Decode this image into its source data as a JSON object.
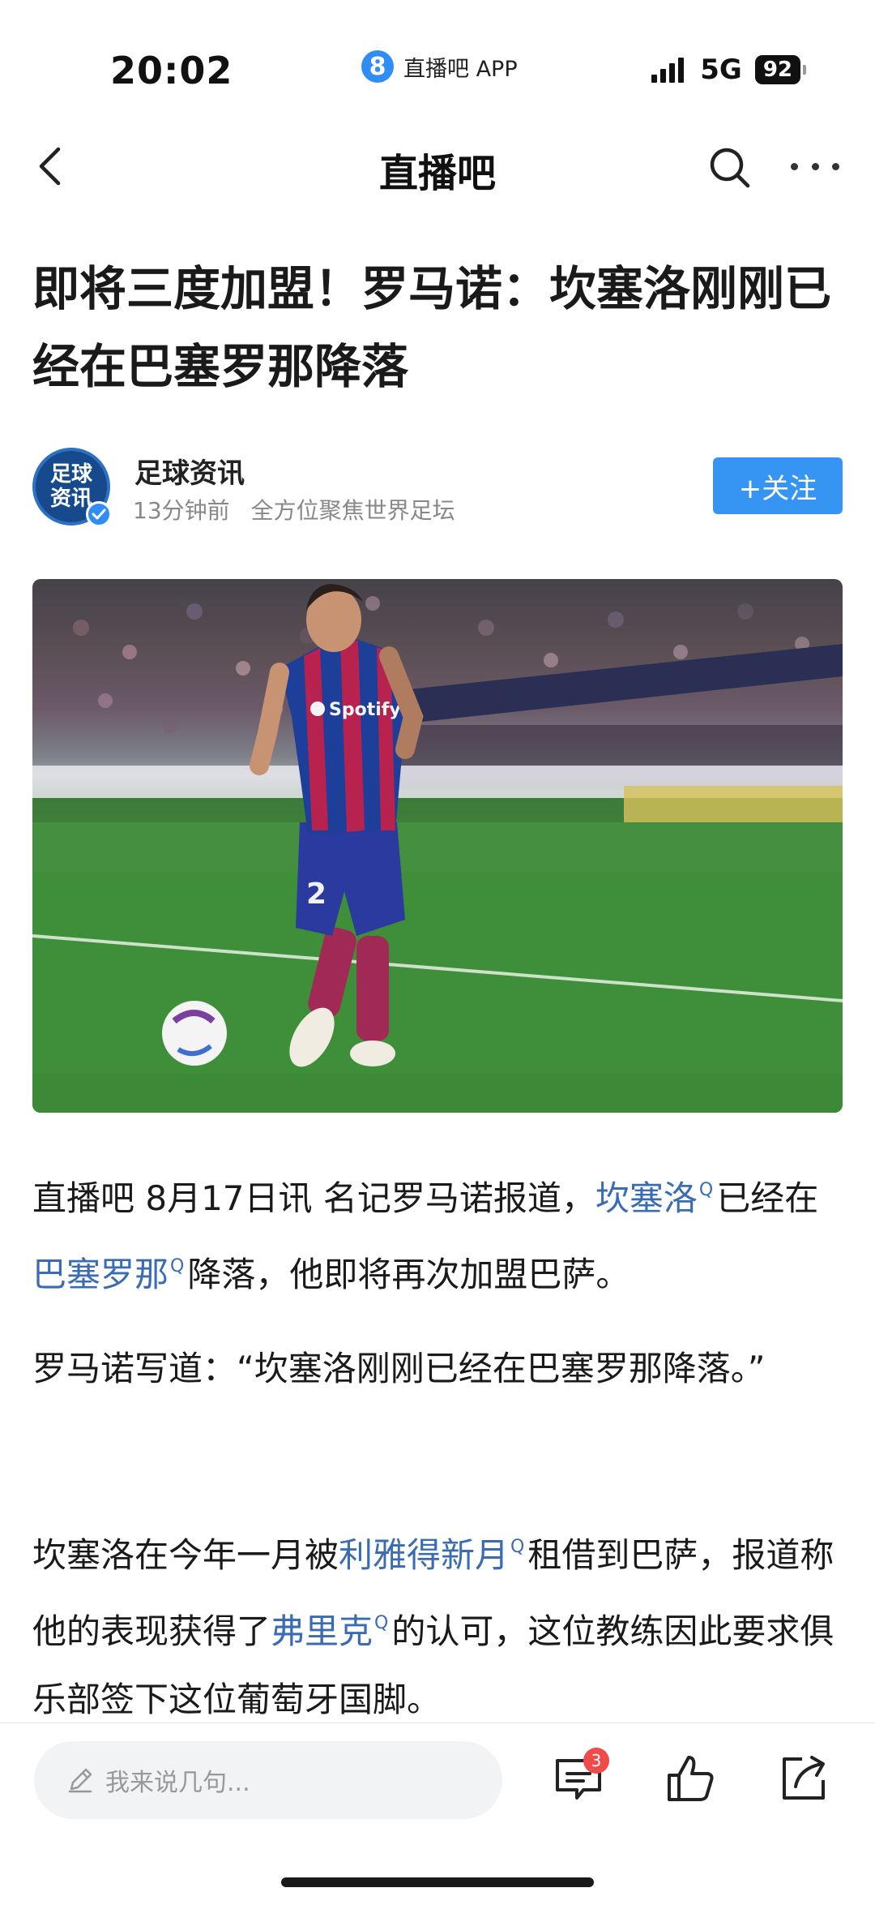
{
  "status_bar": {
    "time": "20:02",
    "app_logo_glyph": "8",
    "app_name": "直播吧 APP",
    "network": "5G",
    "battery": "92"
  },
  "nav": {
    "title": "直播吧",
    "back_icon": "chevron-left-icon",
    "search_icon": "search-icon",
    "more_icon": "more-dots-icon"
  },
  "article": {
    "title": "即将三度加盟！罗马诺：坎塞洛刚刚已经在巴塞罗那降落",
    "author": {
      "avatar_text_line1": "足球",
      "avatar_text_line2": "资讯",
      "name": "足球资讯",
      "time": "13分钟前",
      "tagline": "全方位聚焦世界足坛",
      "follow_label": "+关注"
    },
    "image": {
      "shirt_sponsor": "Spotify",
      "shirt_number": "2"
    },
    "paragraphs": {
      "p1_a": "直播吧 8月17日讯   名记罗马诺报道，",
      "p1_kw1": "坎塞洛",
      "p1_b": "已经在",
      "p1_kw2": "巴塞罗那",
      "p1_c": "降落，他即将再次加盟巴萨。",
      "p2": "罗马诺写道：“坎塞洛刚刚已经在巴塞罗那降落。”",
      "p3_a": "坎塞洛在今年一月被",
      "p3_kw1": "利雅得新月",
      "p3_b": "租借到巴萨，报道称他的表现获得了",
      "p3_kw2": "弗里克",
      "p3_c": "的认可，这位教练因此要求俱乐部签下这位葡萄牙国脚。",
      "keyword_mark": "Q"
    }
  },
  "bottom_bar": {
    "comment_placeholder": "我来说几句...",
    "comment_count": "3",
    "colors": {
      "accent": "#3695f2",
      "link": "#3a6cb4",
      "badge": "#f04b4b"
    }
  }
}
